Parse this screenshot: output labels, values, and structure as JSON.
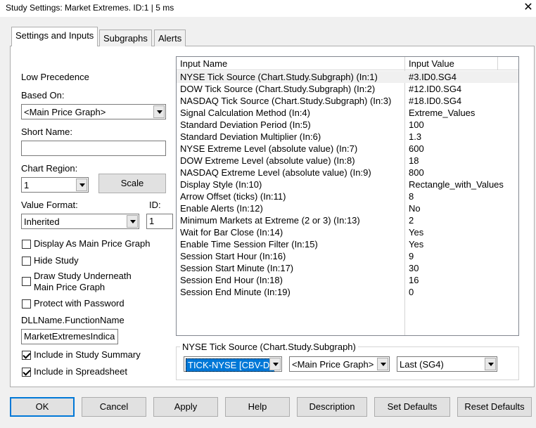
{
  "window": {
    "title": "Study Settings: Market Extremes. ID:1 | 5 ms"
  },
  "tabs": [
    "Settings and Inputs",
    "Subgraphs",
    "Alerts"
  ],
  "left": {
    "low_precedence": "Low Precedence",
    "based_on_label": "Based On:",
    "based_on_value": "<Main Price Graph>",
    "short_name_label": "Short Name:",
    "short_name_value": "",
    "chart_region_label": "Chart Region:",
    "chart_region_value": "1",
    "scale_button": "Scale",
    "value_format_label": "Value Format:",
    "value_format_value": "Inherited",
    "id_label": "ID:",
    "id_value": "1",
    "display_as_main": "Display As Main Price Graph",
    "hide_study": "Hide Study",
    "draw_underneath_1": "Draw Study Underneath",
    "draw_underneath_2": "Main Price Graph",
    "protect_password": "Protect with Password",
    "dll_label": "DLLName.FunctionName",
    "dll_value": "MarketExtremesIndica",
    "include_summary": "Include in Study Summary",
    "include_spreadsheet": "Include in Spreadsheet",
    "checks": {
      "display_as_main": false,
      "hide_study": false,
      "draw_underneath": false,
      "protect_password": false,
      "include_summary": true,
      "include_spreadsheet": true
    }
  },
  "grid": {
    "header_name": "Input Name",
    "header_value": "Input Value",
    "rows": [
      {
        "name": "NYSE Tick Source (Chart.Study.Subgraph)  (In:1)",
        "value": "#3.ID0.SG4"
      },
      {
        "name": "DOW Tick Source (Chart.Study.Subgraph)  (In:2)",
        "value": "#12.ID0.SG4"
      },
      {
        "name": "NASDAQ Tick Source (Chart.Study.Subgraph)  (In:3)",
        "value": "#18.ID0.SG4"
      },
      {
        "name": "Signal Calculation Method  (In:4)",
        "value": "Extreme_Values"
      },
      {
        "name": "Standard Deviation Period  (In:5)",
        "value": "100"
      },
      {
        "name": "Standard Deviation Multiplier  (In:6)",
        "value": "1.3"
      },
      {
        "name": "NYSE Extreme Level (absolute value)  (In:7)",
        "value": "600"
      },
      {
        "name": "DOW Extreme Level (absolute value)  (In:8)",
        "value": "18"
      },
      {
        "name": "NASDAQ Extreme Level (absolute value)  (In:9)",
        "value": "800"
      },
      {
        "name": "Display Style  (In:10)",
        "value": "Rectangle_with_Values"
      },
      {
        "name": "Arrow Offset (ticks)  (In:11)",
        "value": "8"
      },
      {
        "name": "Enable Alerts  (In:12)",
        "value": "No"
      },
      {
        "name": "Minimum Markets at Extreme (2 or 3)  (In:13)",
        "value": "2"
      },
      {
        "name": "Wait for Bar Close  (In:14)",
        "value": "Yes"
      },
      {
        "name": "Enable Time Session Filter  (In:15)",
        "value": "Yes"
      },
      {
        "name": "Session Start Hour  (In:16)",
        "value": "9"
      },
      {
        "name": "Session Start Minute  (In:17)",
        "value": "30"
      },
      {
        "name": "Session End Hour  (In:18)",
        "value": "16"
      },
      {
        "name": "Session End Minute  (In:19)",
        "value": "0"
      }
    ]
  },
  "source_group": {
    "title": "NYSE Tick Source (Chart.Study.Subgraph)",
    "chart_value": "TICK-NYSE [CBV-D]",
    "study_value": "<Main Price Graph>",
    "subgraph_value": "Last (SG4)"
  },
  "buttons": [
    "OK",
    "Cancel",
    "Apply",
    "Help",
    "Description",
    "Set Defaults",
    "Reset Defaults"
  ]
}
